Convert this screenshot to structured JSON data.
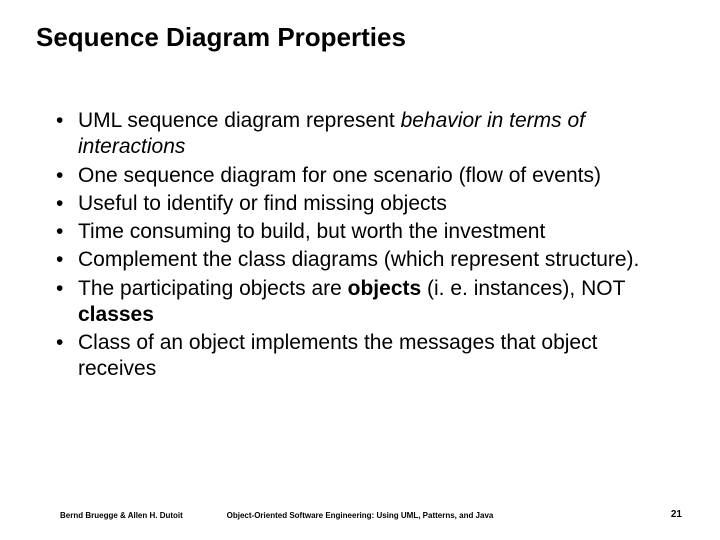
{
  "title": "Sequence Diagram Properties",
  "bullets": [
    {
      "pre": "UML sequence diagram represent ",
      "em": "behavior in terms of interactions",
      "post": ""
    },
    {
      "pre": "One sequence diagram for one scenario (flow of events)",
      "em": "",
      "post": ""
    },
    {
      "pre": "Useful to identify or find missing objects",
      "em": "",
      "post": ""
    },
    {
      "pre": "Time consuming to build, but worth the investment",
      "em": "",
      "post": ""
    },
    {
      "pre": "Complement the class diagrams (which represent structure).",
      "em": "",
      "post": ""
    },
    {
      "pre": "The participating objects are ",
      "b1": "objects",
      "mid": " (i. e. instances), NOT ",
      "b2": "classes",
      "post": ""
    },
    {
      "pre": "Class of an object implements the messages that object receives",
      "em": "",
      "post": ""
    }
  ],
  "footer": {
    "left": "Bernd Bruegge & Allen H. Dutoit",
    "center": "Object-Oriented Software Engineering: Using UML, Patterns, and Java",
    "right": "21"
  }
}
